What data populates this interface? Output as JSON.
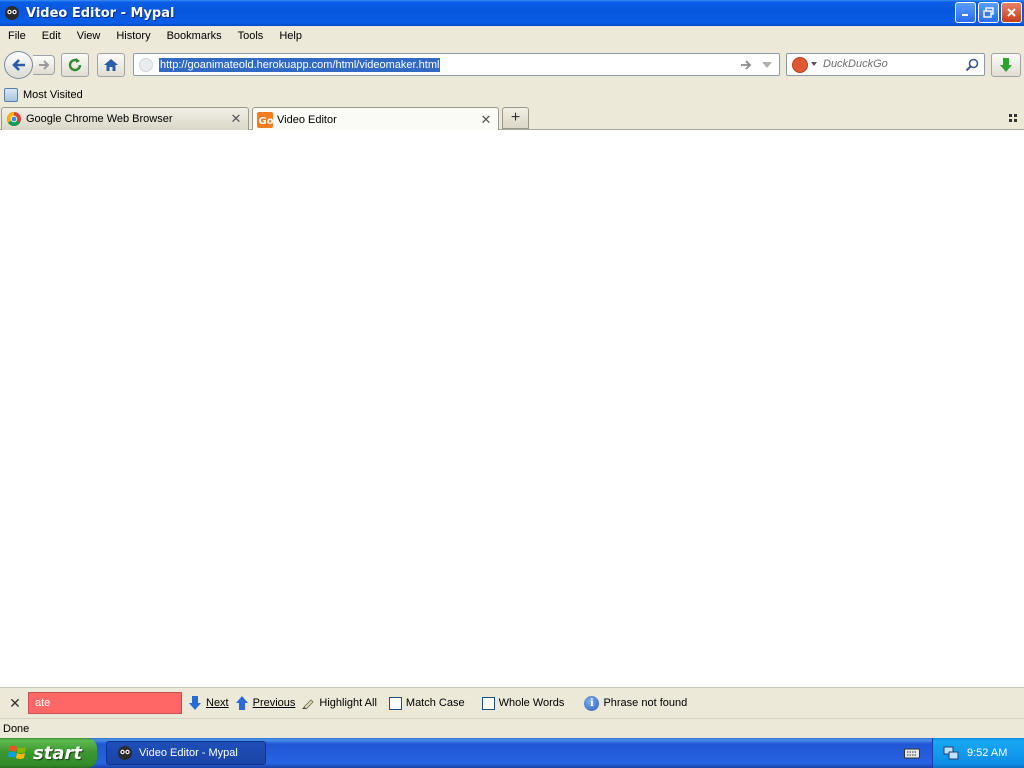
{
  "window": {
    "title": "Video Editor - Mypal"
  },
  "menubar": {
    "items": [
      "File",
      "Edit",
      "View",
      "History",
      "Bookmarks",
      "Tools",
      "Help"
    ]
  },
  "navbar": {
    "url": "http://goanimateold.herokuapp.com/html/videomaker.html",
    "search_placeholder": "DuckDuckGo"
  },
  "bookmarks": {
    "most_visited": "Most Visited"
  },
  "tabs": [
    {
      "label": "Google Chrome Web Browser",
      "active": false
    },
    {
      "label": "Video Editor",
      "active": true
    }
  ],
  "findbar": {
    "query": "ate",
    "next_label": "Next",
    "previous_label": "Previous",
    "highlight_all_label": "Highlight All",
    "match_case_label": "Match Case",
    "whole_words_label": "Whole Words",
    "status": "Phrase not found"
  },
  "statusbar": {
    "text": "Done"
  },
  "taskbar": {
    "start_label": "start",
    "task_label": "Video Editor - Mypal",
    "clock": "9:52 AM"
  },
  "colors": {
    "find_not_found_bg": "#ff6666",
    "url_selection": "#316ac5",
    "chrome_bg": "#ece9d8"
  }
}
